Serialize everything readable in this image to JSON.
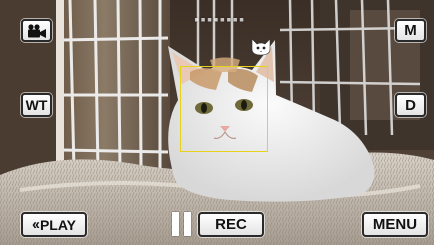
{
  "colors": {
    "face_frame": "#e6d21a",
    "button_bg": "#ffffff",
    "button_border": "#2a2a2a",
    "button_text": "#111111"
  },
  "status": {
    "recording_info": "▪▪▪▪▪▪▪▪"
  },
  "controls": {
    "camera_mode_icon": "video-camera-icon",
    "wt_label": "WT",
    "m_label": "M",
    "d_label": "D",
    "play_label": "PLAY",
    "play_icon": "double-chevron-left-icon",
    "pause_icon": "pause-icon",
    "rec_label": "REC",
    "menu_label": "MENU"
  },
  "overlays": {
    "face_detection": "face-detection-frame",
    "pet_icon": "cat-face-icon"
  }
}
